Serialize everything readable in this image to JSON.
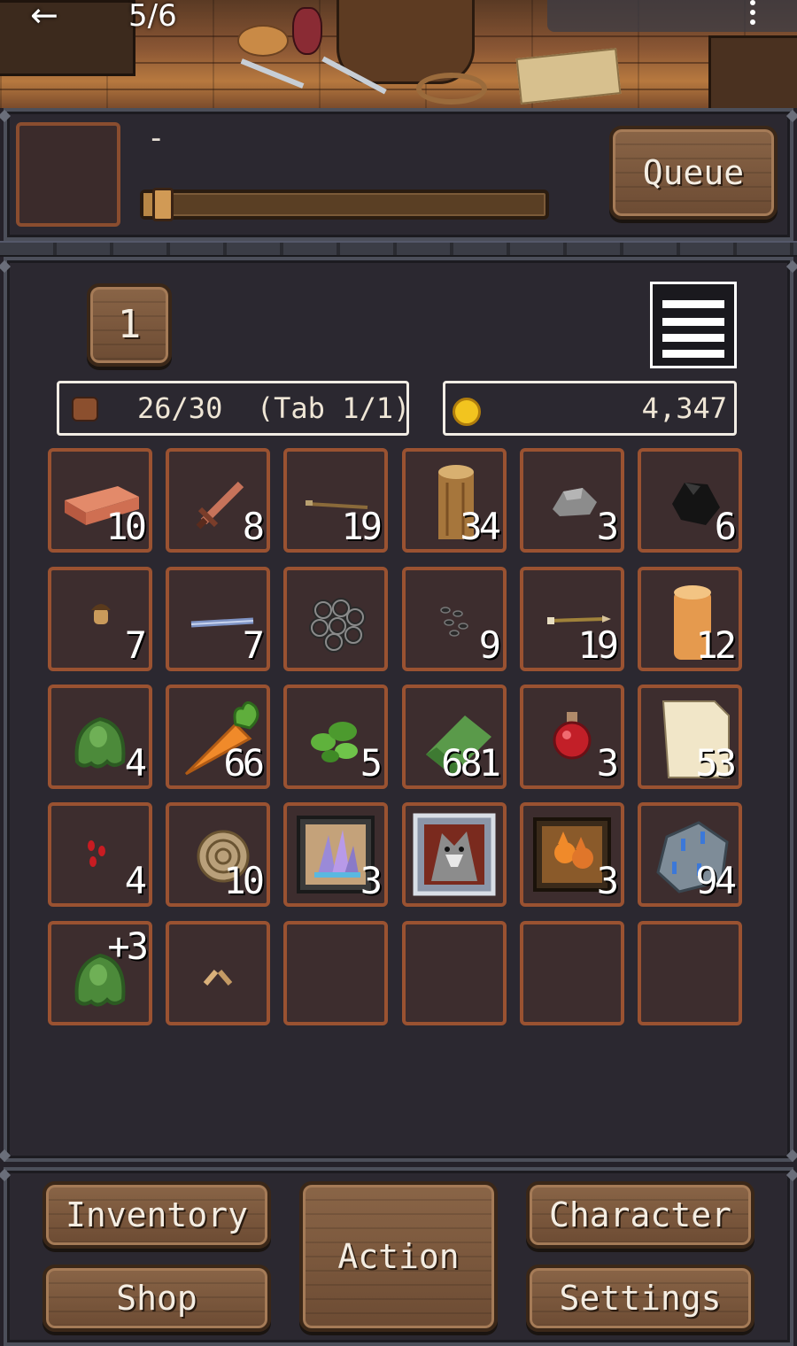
{
  "header": {
    "page_counter": "5/6",
    "back_glyph": "←",
    "menu_icon": "more-vert-icon"
  },
  "queue": {
    "current_action": "-",
    "progress": 0.04,
    "button_label": "Queue"
  },
  "inventory": {
    "tab_number": "1",
    "capacity_text": "26/30  (Tab 1/1)",
    "gold": "4,347",
    "slots": [
      {
        "item": "copper-bar-icon",
        "qty": "10"
      },
      {
        "item": "copper-dagger-icon",
        "qty": "8"
      },
      {
        "item": "arrow-shaft-icon",
        "qty": "19"
      },
      {
        "item": "log-icon",
        "qty": "34"
      },
      {
        "item": "stone-icon",
        "qty": "3"
      },
      {
        "item": "coal-icon",
        "qty": "6"
      },
      {
        "item": "acorn-icon",
        "qty": "7"
      },
      {
        "item": "iron-bolt-icon",
        "qty": "7"
      },
      {
        "item": "chainmail-icon",
        "qty": ""
      },
      {
        "item": "seeds-icon",
        "qty": "9"
      },
      {
        "item": "arrow-icon",
        "qty": "19"
      },
      {
        "item": "oak-log-icon",
        "qty": "12"
      },
      {
        "item": "slime-icon",
        "qty": "4"
      },
      {
        "item": "carrot-icon",
        "qty": "66"
      },
      {
        "item": "herb-icon",
        "qty": "5"
      },
      {
        "item": "green-cloth-icon",
        "qty": "681"
      },
      {
        "item": "health-potion-icon",
        "qty": "3"
      },
      {
        "item": "paper-icon",
        "qty": "53"
      },
      {
        "item": "berries-icon",
        "qty": "4"
      },
      {
        "item": "ammonite-fossil-icon",
        "qty": "10"
      },
      {
        "item": "crystal-painting-icon",
        "qty": "3"
      },
      {
        "item": "wolf-painting-icon",
        "qty": ""
      },
      {
        "item": "fox-painting-icon",
        "qty": "3"
      },
      {
        "item": "rune-stone-icon",
        "qty": "94"
      },
      {
        "item": "slime-upgraded-icon",
        "qty": "+3"
      },
      {
        "item": "wood-chips-icon",
        "qty": ""
      },
      {
        "item": "",
        "qty": ""
      },
      {
        "item": "",
        "qty": ""
      },
      {
        "item": "",
        "qty": ""
      },
      {
        "item": "",
        "qty": ""
      }
    ]
  },
  "nav": {
    "inventory": "Inventory",
    "shop": "Shop",
    "action": "Action",
    "character": "Character",
    "settings": "Settings"
  },
  "colors": {
    "slot_border": "#9a5231",
    "slot_bg": "#3d2d2e",
    "wood_button": "#7a573c",
    "panel_bg": "#2b2830",
    "gold": "#f2c41f"
  }
}
